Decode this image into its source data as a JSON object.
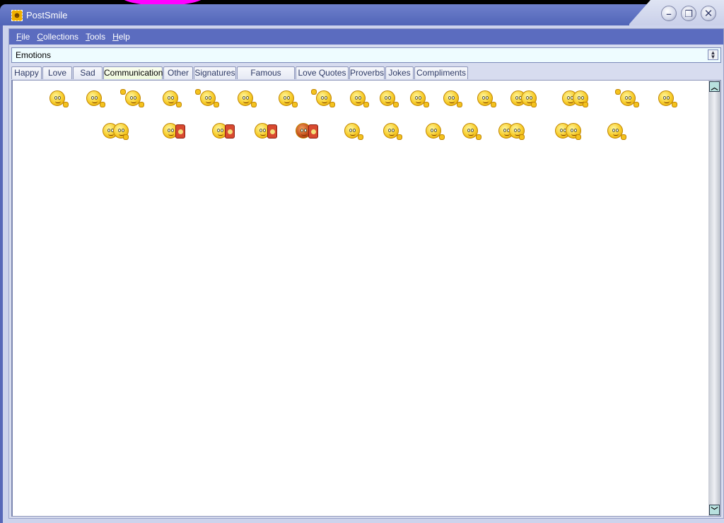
{
  "window": {
    "title": "PostSmile",
    "app_icon": "smiley-icon",
    "controls": {
      "minimize": "minimize-icon",
      "restore": "restore-icon",
      "close": "close-icon"
    }
  },
  "menubar": {
    "items": [
      {
        "label": "File",
        "accel": "F"
      },
      {
        "label": "Collections",
        "accel": "C"
      },
      {
        "label": "Tools",
        "accel": "T"
      },
      {
        "label": "Help",
        "accel": "H"
      }
    ]
  },
  "collection_select": {
    "value": "Emotions"
  },
  "tabs": [
    {
      "label": "Happy",
      "active": false
    },
    {
      "label": "Love",
      "active": false
    },
    {
      "label": "Sad",
      "active": false
    },
    {
      "label": "Communication",
      "active": true
    },
    {
      "label": "Other",
      "active": false
    },
    {
      "label": "Signatures",
      "active": false
    },
    {
      "label": "Famous Quotes",
      "active": false
    },
    {
      "label": "Love Quotes",
      "active": false
    },
    {
      "label": "Proverbs",
      "active": false
    },
    {
      "label": "Jokes",
      "active": false
    },
    {
      "label": "Compliments",
      "active": false
    }
  ],
  "smileys": {
    "row1": [
      {
        "kind": "waving"
      },
      {
        "kind": "waving"
      },
      {
        "kind": "both-hands-up"
      },
      {
        "kind": "shrug"
      },
      {
        "kind": "both-hands-up"
      },
      {
        "kind": "waving"
      },
      {
        "kind": "waving"
      },
      {
        "kind": "sad-wave"
      },
      {
        "kind": "leaning"
      },
      {
        "kind": "leaning"
      },
      {
        "kind": "crying"
      },
      {
        "kind": "neutral"
      },
      {
        "kind": "leaning"
      },
      {
        "kind": "pair-talking",
        "wide": true
      },
      {
        "kind": "pair-talking",
        "wide": true
      },
      {
        "kind": "finger-up"
      },
      {
        "kind": "neutral"
      }
    ],
    "row2": [
      {
        "kind": "pair-gesture",
        "wide": true
      },
      {
        "kind": "phone"
      },
      {
        "kind": "phone"
      },
      {
        "kind": "phone"
      },
      {
        "kind": "phone-angry"
      },
      {
        "kind": "shrug"
      },
      {
        "kind": "surprised"
      },
      {
        "kind": "waving"
      },
      {
        "kind": "leaning"
      },
      {
        "kind": "pair-whisper",
        "wide": true
      },
      {
        "kind": "pair-whisper",
        "wide": true
      },
      {
        "kind": "covering-mouth"
      }
    ]
  },
  "scrollbar": {
    "up": "scroll-up-arrow-icon",
    "down": "scroll-down-arrow-icon"
  }
}
